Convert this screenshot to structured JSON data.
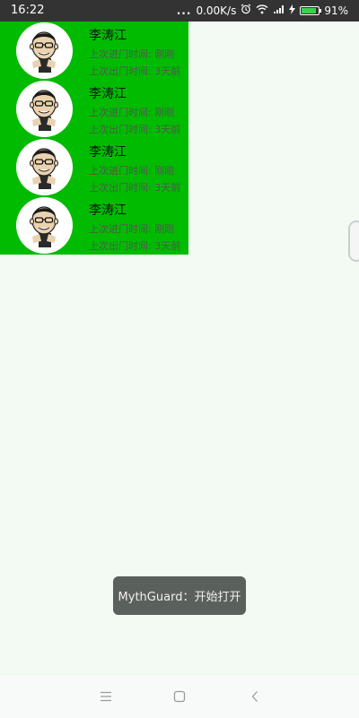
{
  "status_bar": {
    "time": "16:22",
    "dots": "...",
    "network_speed": "0.00K/s",
    "battery_percent": "91%",
    "battery_level": 0.91,
    "icons": [
      "alarm-icon",
      "wifi-icon",
      "signal-icon",
      "charging-icon",
      "battery-icon"
    ]
  },
  "list": {
    "items": [
      {
        "name": "李涛江",
        "last_enter": "上次进门时间: 刚刚",
        "last_exit": "上次出门时间: 3天前"
      },
      {
        "name": "李涛江",
        "last_enter": "上次进门时间: 刚刚",
        "last_exit": "上次出门时间: 3天前"
      },
      {
        "name": "李涛江",
        "last_enter": "上次进门时间: 刚刚",
        "last_exit": "上次出门时间: 3天前"
      },
      {
        "name": "李涛江",
        "last_enter": "上次进门时间: 刚刚",
        "last_exit": "上次出门时间: 3天前"
      }
    ],
    "background_color": "#00bb00"
  },
  "toast": {
    "text": "MythGuard：开始打开"
  },
  "nav_bar": {
    "icons": [
      "menu-icon",
      "home-icon",
      "back-icon"
    ]
  }
}
